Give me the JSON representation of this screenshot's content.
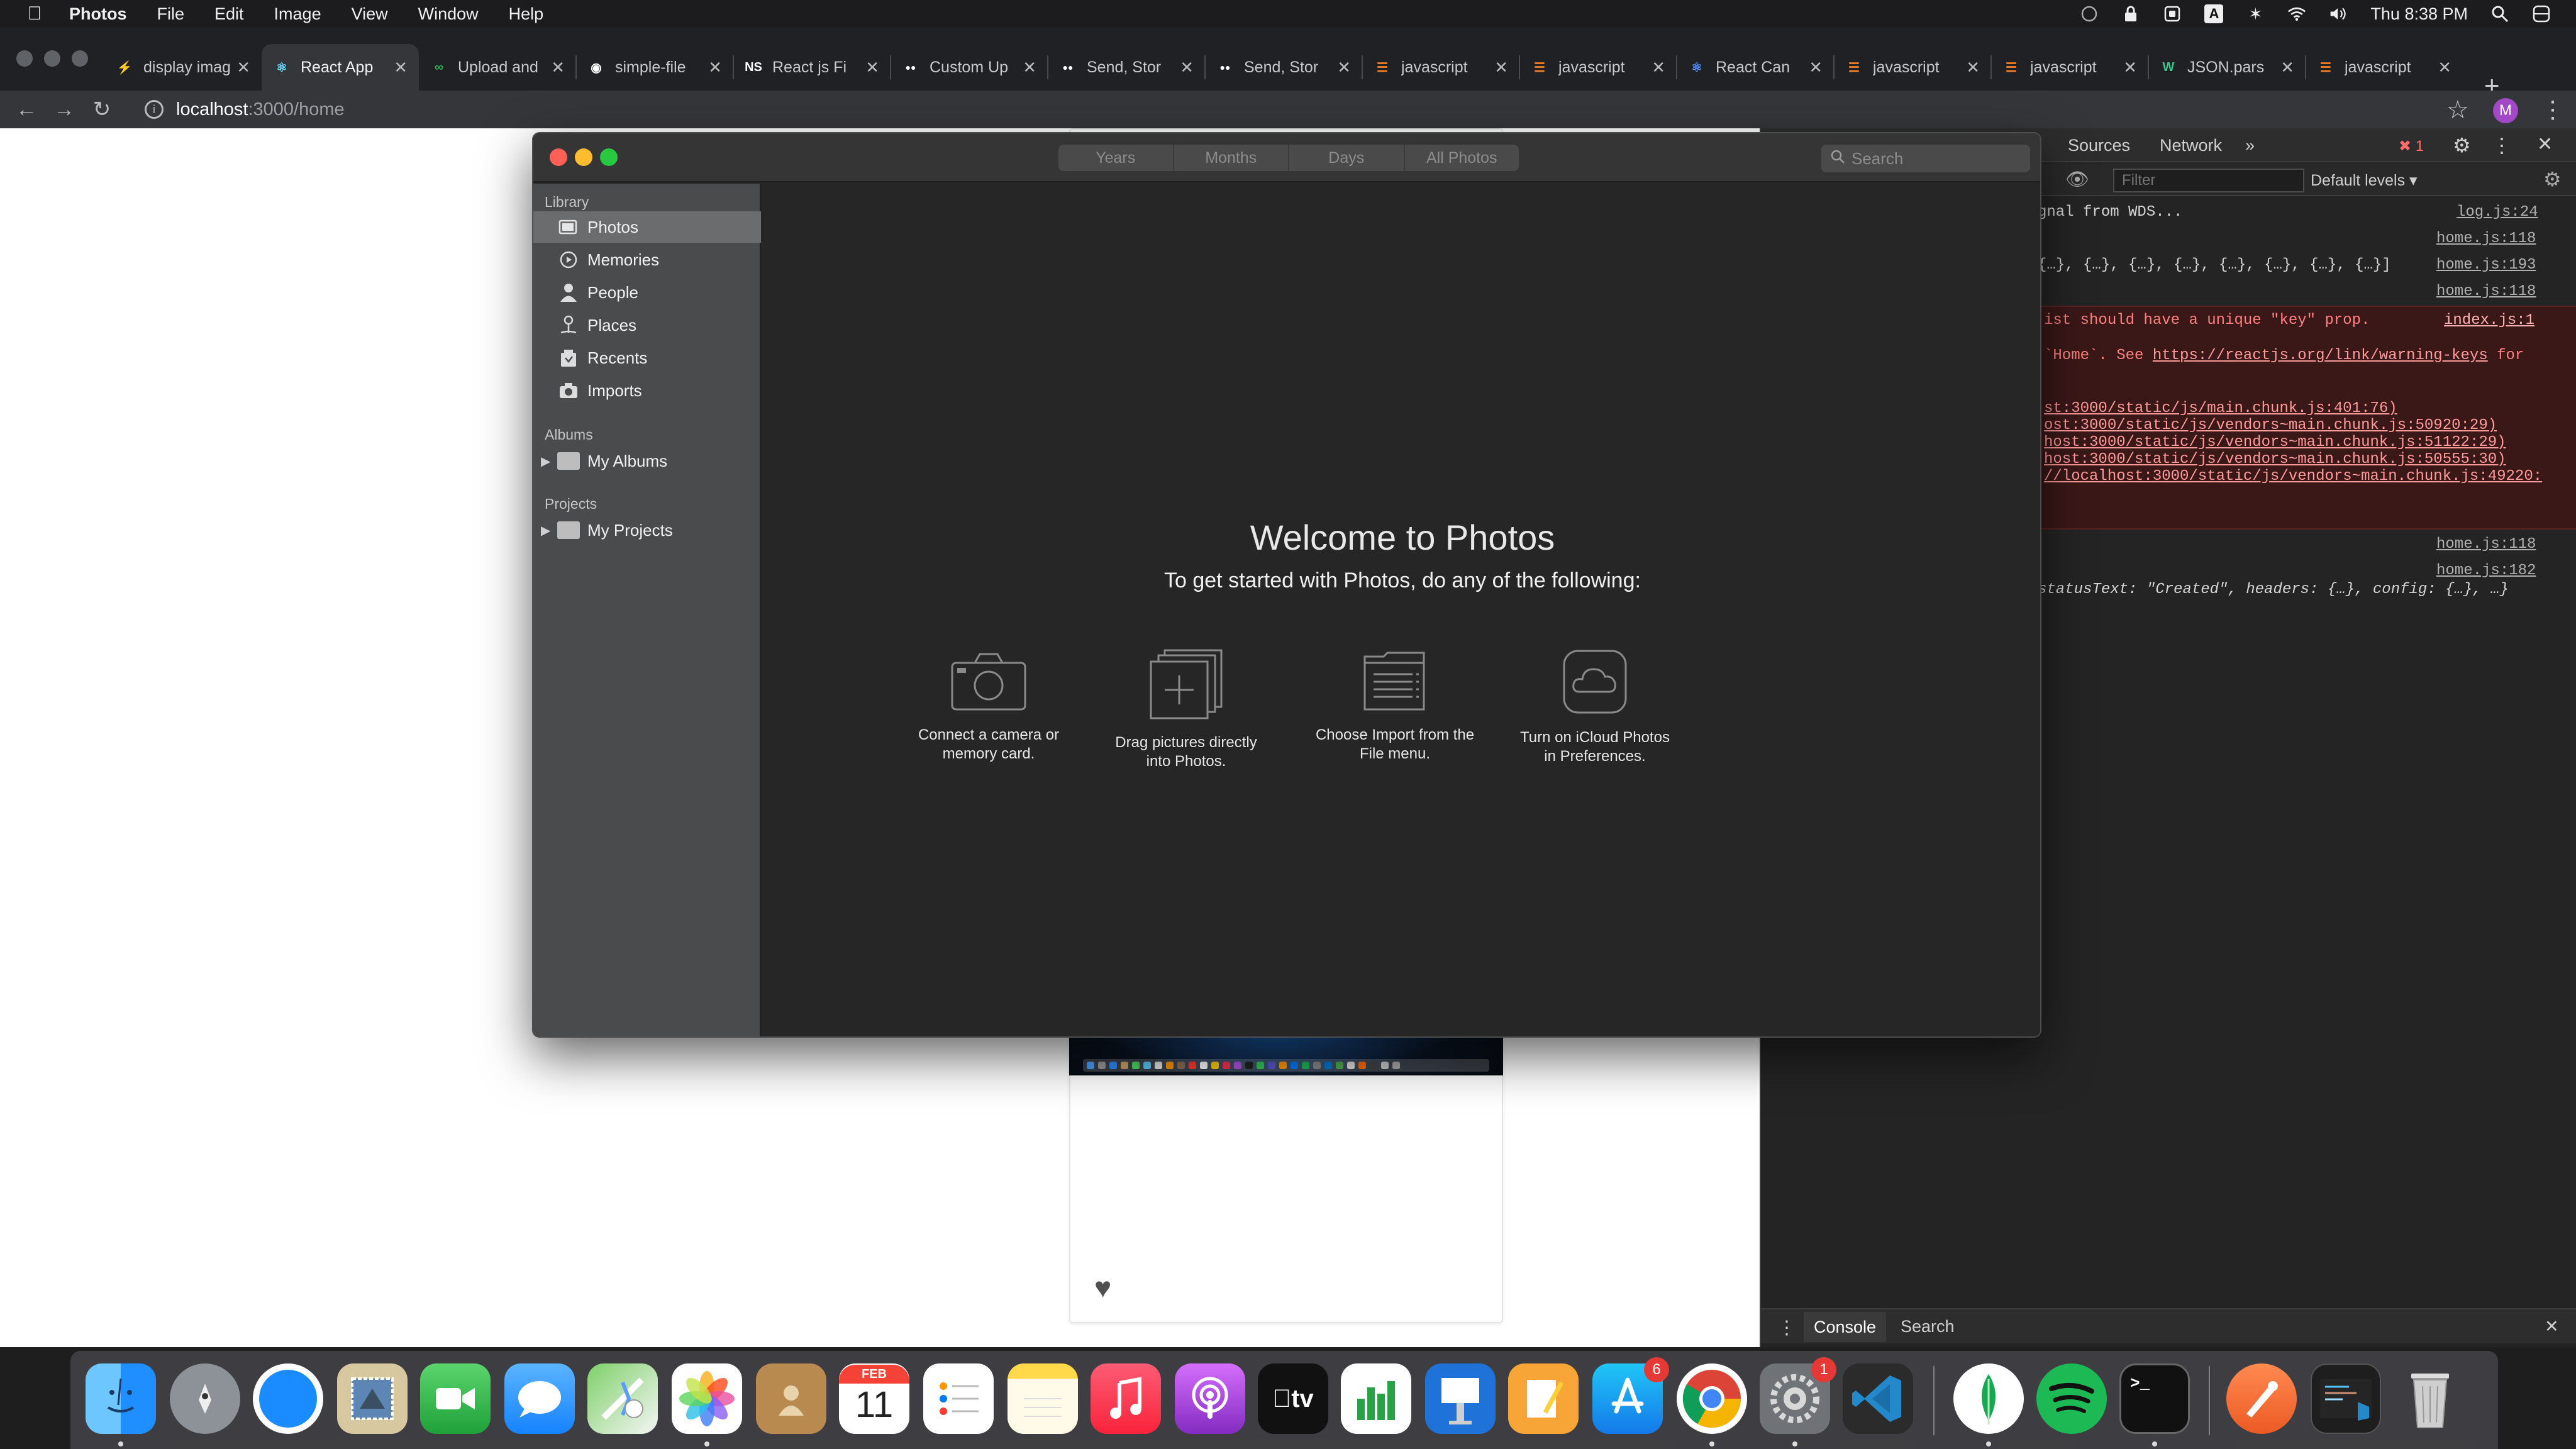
{
  "menubar": {
    "app_name": "Photos",
    "menus": [
      "File",
      "Edit",
      "Image",
      "View",
      "Window",
      "Help"
    ],
    "clock": "Thu 8:38 PM"
  },
  "browser": {
    "tabs": [
      {
        "title": "display image",
        "favicon": "bolt",
        "active": false
      },
      {
        "title": "React App",
        "favicon": "react",
        "active": true
      },
      {
        "title": "Upload and",
        "favicon": "link",
        "active": false
      },
      {
        "title": "simple-file",
        "favicon": "github",
        "active": false
      },
      {
        "title": "React js Fi",
        "favicon": "NS",
        "active": false
      },
      {
        "title": "Custom Up",
        "favicon": "medium",
        "active": false
      },
      {
        "title": "Send, Stor",
        "favicon": "medium",
        "active": false
      },
      {
        "title": "Send, Stor",
        "favicon": "medium",
        "active": false
      },
      {
        "title": "javascript",
        "favicon": "stackoverflow",
        "active": false
      },
      {
        "title": "javascript",
        "favicon": "stackoverflow",
        "active": false
      },
      {
        "title": "React Can",
        "favicon": "react-blue",
        "active": false
      },
      {
        "title": "javascript",
        "favicon": "stackoverflow",
        "active": false
      },
      {
        "title": "javascript",
        "favicon": "stackoverflow",
        "active": false
      },
      {
        "title": "JSON.pars",
        "favicon": "W",
        "active": false
      },
      {
        "title": "javascript",
        "favicon": "stackoverflow",
        "active": false
      }
    ],
    "url_host": "localhost",
    "url_path": ":3000/home",
    "profile_initial": "M"
  },
  "devtools": {
    "tabs": [
      "Sources",
      "Network"
    ],
    "error_count": "1",
    "filter_placeholder": "Filter",
    "levels_label": "Default levels",
    "logs": [
      {
        "text": "gnal from WDS...",
        "src": "log.js:24"
      },
      {
        "text": "",
        "src": "home.js:118"
      },
      {
        "text": "{…}, {…}, {…}, {…}, {…}, {…}, {…}, {…}]",
        "src": "home.js:193"
      },
      {
        "text": "",
        "src": "home.js:118"
      }
    ],
    "error": {
      "line1": "ist should have a unique \"key\" prop.",
      "src": "index.js:1",
      "line2_prefix": "`Home`. See ",
      "line2_link": "https://reactjs.org/link/warning-keys",
      "line2_suffix": " for",
      "stack": [
        "st:3000/static/js/main.chunk.js:401:76)",
        "ost:3000/static/js/vendors~main.chunk.js:50920:29)",
        "host:3000/static/js/vendors~main.chunk.js:51122:29)",
        "host:3000/static/js/vendors~main.chunk.js:50555:30)",
        "//localhost:3000/static/js/vendors~main.chunk.js:49220:"
      ]
    },
    "logs_after": [
      {
        "text": "",
        "src": "home.js:118"
      },
      {
        "text": "",
        "src": "home.js:182"
      },
      {
        "text": "statusText: \"Created\", headers: {…}, config: {…}, …}",
        "src": ""
      }
    ],
    "drawer_tabs": [
      "Console",
      "Search"
    ]
  },
  "photos": {
    "segments": [
      "Years",
      "Months",
      "Days",
      "All Photos"
    ],
    "search_placeholder": "Search",
    "sidebar": {
      "library_label": "Library",
      "library_items": [
        {
          "label": "Photos",
          "icon": "photos-icon",
          "selected": true
        },
        {
          "label": "Memories",
          "icon": "memories-icon",
          "selected": false
        },
        {
          "label": "People",
          "icon": "person-icon",
          "selected": false
        },
        {
          "label": "Places",
          "icon": "pin-icon",
          "selected": false
        },
        {
          "label": "Recents",
          "icon": "recents-icon",
          "selected": false
        },
        {
          "label": "Imports",
          "icon": "camera-icon",
          "selected": false
        }
      ],
      "albums_label": "Albums",
      "albums_item": "My Albums",
      "projects_label": "Projects",
      "projects_item": "My Projects"
    },
    "welcome_title": "Welcome to Photos",
    "welcome_subtitle": "To get started with Photos, do any of the following:",
    "options": [
      {
        "line1": "Connect a camera or",
        "line2": "memory card.",
        "icon": "camera-icon"
      },
      {
        "line1": "Drag pictures directly",
        "line2": "into Photos.",
        "icon": "add-photos-icon"
      },
      {
        "line1": "Choose Import from the",
        "line2": "File menu.",
        "icon": "import-icon"
      },
      {
        "line1": "Turn on iCloud Photos",
        "line2": "in Preferences.",
        "icon": "icloud-icon"
      }
    ]
  },
  "dock": {
    "calendar_month": "FEB",
    "calendar_day": "11",
    "appstore_badge": "6",
    "syspref_badge": "1",
    "tv_label": "tv"
  }
}
